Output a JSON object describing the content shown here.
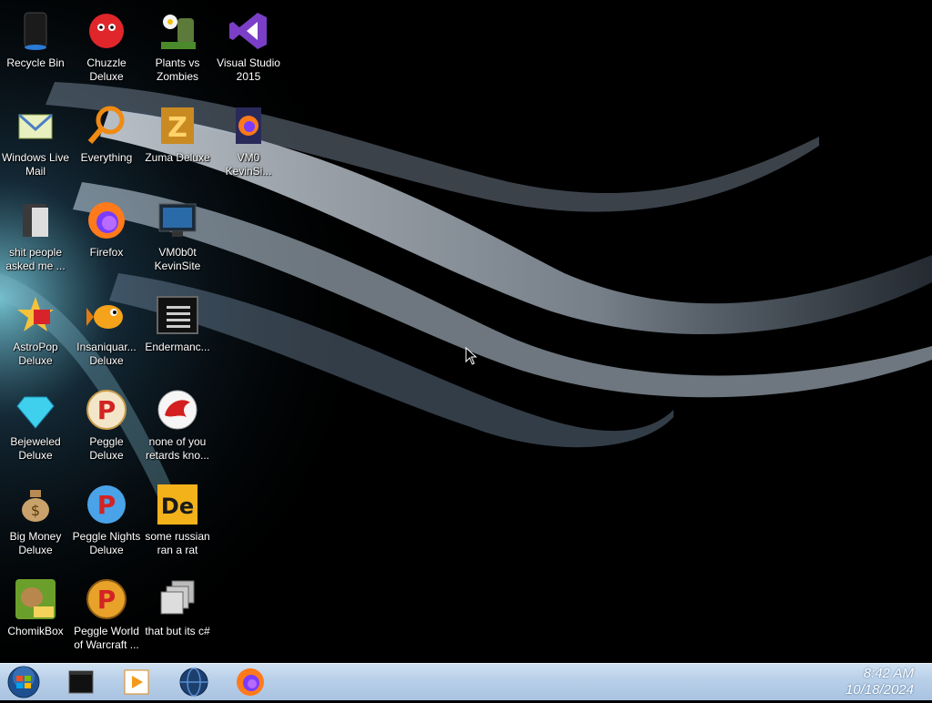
{
  "desktop": {
    "icons": [
      {
        "label": "Recycle Bin",
        "icon": "recycle-bin-icon"
      },
      {
        "label": "Chuzzle Deluxe",
        "icon": "chuzzle-icon"
      },
      {
        "label": "Plants vs Zombies",
        "icon": "plants-vs-zombies-icon"
      },
      {
        "label": "Visual Studio 2015",
        "icon": "visual-studio-icon"
      },
      {
        "label": "Windows Live Mail",
        "icon": "mail-icon"
      },
      {
        "label": "Everything",
        "icon": "magnifier-icon"
      },
      {
        "label": "Zuma Deluxe",
        "icon": "zuma-icon"
      },
      {
        "label": "VM0 KevinSi...",
        "icon": "firefox-file-icon"
      },
      {
        "label": "shit people asked me ...",
        "icon": "folder-icon"
      },
      {
        "label": "Firefox",
        "icon": "firefox-icon"
      },
      {
        "label": "VM0b0t KevinSite",
        "icon": "monitor-icon"
      },
      {
        "label": "AstroPop Deluxe",
        "icon": "astropop-icon"
      },
      {
        "label": "Insaniquar... Deluxe",
        "icon": "fish-icon"
      },
      {
        "label": "Endermanc...",
        "icon": "terminal-icon"
      },
      {
        "label": "Bejeweled Deluxe",
        "icon": "gem-icon"
      },
      {
        "label": "Peggle Deluxe",
        "icon": "peggle-icon"
      },
      {
        "label": "none of you retards kno...",
        "icon": "red-dragon-icon"
      },
      {
        "label": "Big Money Deluxe",
        "icon": "money-bag-icon"
      },
      {
        "label": "Peggle Nights Deluxe",
        "icon": "peggle-nights-icon"
      },
      {
        "label": "some russian ran a rat",
        "icon": "de-icon"
      },
      {
        "label": "ChomikBox",
        "icon": "chomikbox-icon"
      },
      {
        "label": "Peggle World of Warcraft ...",
        "icon": "peggle-wow-icon"
      },
      {
        "label": "that but its c#",
        "icon": "copy-windows-icon"
      }
    ]
  },
  "taskbar": {
    "items": [
      "start-orb-icon",
      "black-window-icon",
      "media-player-icon",
      "globe-icon",
      "firefox-icon"
    ],
    "time": "8:42 AM",
    "date": "10/18/2024"
  },
  "colors": {
    "taskbar": "#b8cfe8",
    "wallpaper_dark": "#000000",
    "wallpaper_light": "#dfe9f2"
  }
}
